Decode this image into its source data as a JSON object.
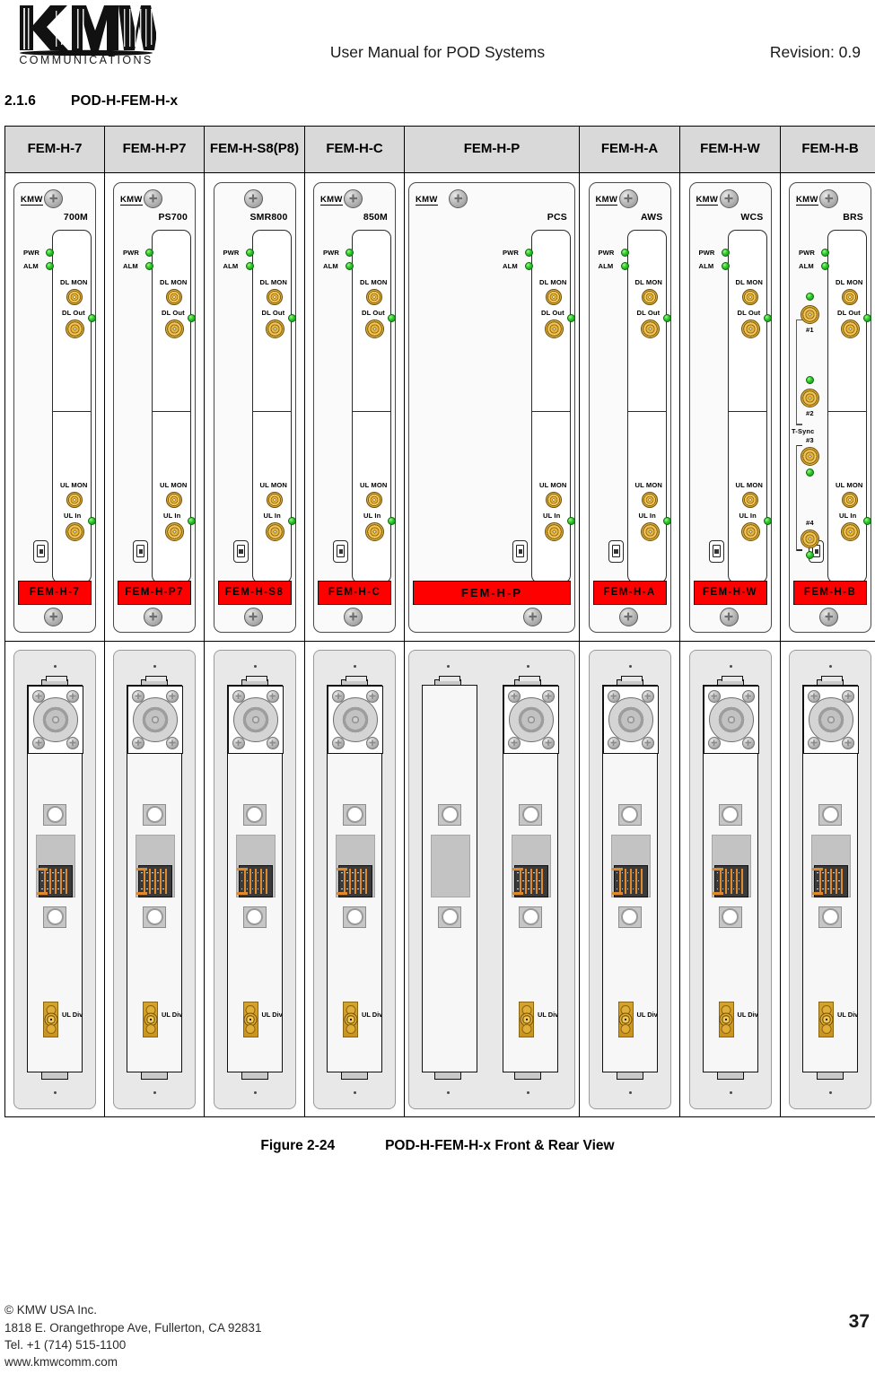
{
  "header": {
    "logo_word": "COMMUNICATIONS",
    "title": "User Manual for POD Systems",
    "revision": "Revision: 0.9"
  },
  "section": {
    "number": "2.1.6",
    "title": "POD-H-FEM-H-x"
  },
  "table": {
    "columns": [
      "FEM-H-7",
      "FEM-H-P7",
      "FEM-H-S8(P8)",
      "FEM-H-C",
      "FEM-H-P",
      "FEM-H-A",
      "FEM-H-W",
      "FEM-H-B"
    ]
  },
  "common_labels": {
    "brand": "KMW",
    "pwr": "PWR",
    "alm": "ALM",
    "dl_mon": "DL MON",
    "dl_out": "DL Out",
    "ul_mon": "UL MON",
    "ul_in": "UL In",
    "ul_div": "UL Div",
    "tsync": "T-Sync",
    "tsync_ports": [
      "#1",
      "#2",
      "#3",
      "#4"
    ]
  },
  "modules": [
    {
      "band": "700M",
      "tag": "FEM-H-7",
      "brand": "KMW",
      "wide": false,
      "tsync": false
    },
    {
      "band": "PS700",
      "tag": "FEM-H-P7",
      "brand": "KMW",
      "wide": false,
      "tsync": false
    },
    {
      "band": "SMR800",
      "tag": "FEM-H-S8",
      "brand": "",
      "wide": false,
      "tsync": false
    },
    {
      "band": "850M",
      "tag": "FEM-H-C",
      "brand": "KMW",
      "wide": false,
      "tsync": false
    },
    {
      "band": "PCS",
      "tag": "FEM-H-P",
      "brand": "KMW",
      "wide": true,
      "tsync": false
    },
    {
      "band": "AWS",
      "tag": "FEM-H-A",
      "brand": "KMW",
      "wide": false,
      "tsync": false
    },
    {
      "band": "WCS",
      "tag": "FEM-H-W",
      "brand": "KMW",
      "wide": false,
      "tsync": false
    },
    {
      "band": "BRS",
      "tag": "FEM-H-B",
      "brand": "KMW",
      "wide": false,
      "tsync": true
    }
  ],
  "figure": {
    "label": "Figure 2-24",
    "title": "POD-H-FEM-H-x Front & Rear View"
  },
  "footer": {
    "line1": "© KMW USA Inc.",
    "line2": "1818 E. Orangethrope Ave, Fullerton, CA 92831",
    "line3": "Tel. +1 (714) 515-1100",
    "line4": "www.kmwcomm.com",
    "page": "37"
  },
  "colors": {
    "red_label": "#fe0000",
    "led_green": "#2fc62f",
    "connector_gold": "#e2ae34",
    "header_gray": "#d9d9d9"
  }
}
